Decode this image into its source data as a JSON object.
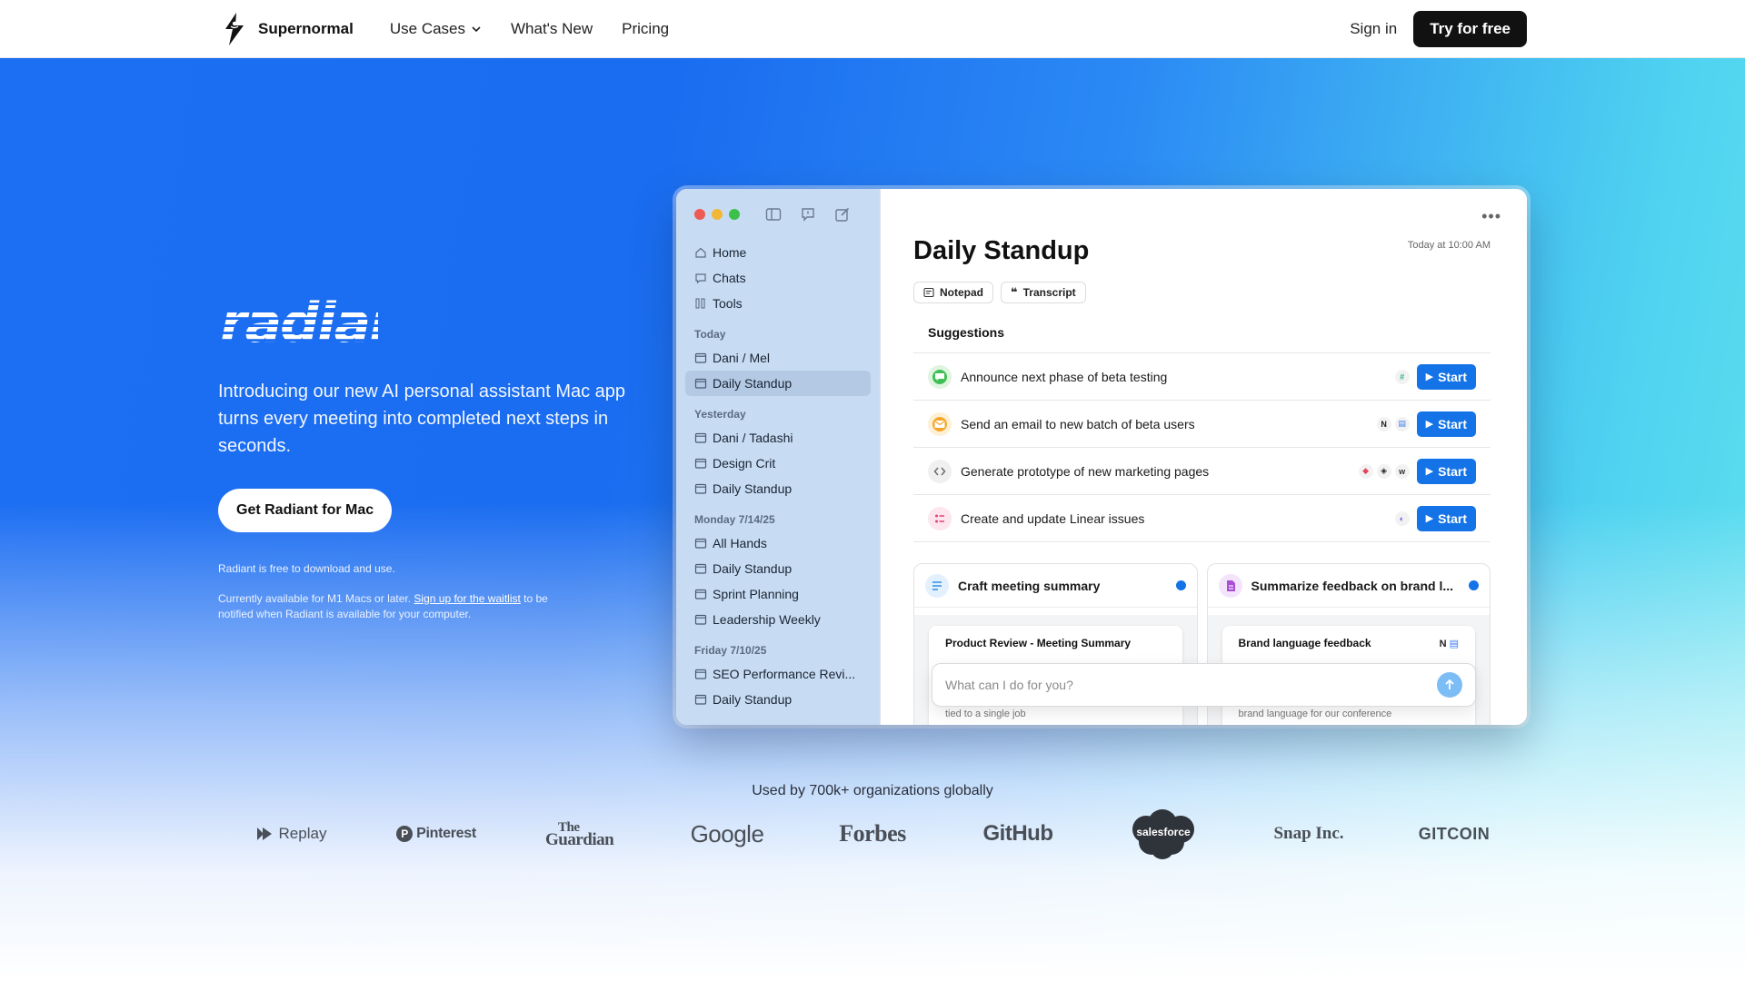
{
  "nav": {
    "brand": "Supernormal",
    "links": {
      "use_cases": "Use Cases",
      "whats_new": "What's New",
      "pricing": "Pricing"
    },
    "sign_in": "Sign in",
    "try_free": "Try for free"
  },
  "hero": {
    "logo_text": "radiant",
    "tagline": "Introducing our new AI personal assistant Mac app turns every meeting into completed next steps in seconds.",
    "cta": "Get Radiant for Mac",
    "note_free": "Radiant is free to download and use.",
    "note_avail_pre": "Currently available for M1 Macs or later. ",
    "note_avail_link": "Sign up for the waitlist",
    "note_avail_post": " to be notified when Radiant is available for your computer."
  },
  "app": {
    "sidebar": {
      "nav": [
        "Home",
        "Chats",
        "Tools"
      ],
      "sections": [
        {
          "label": "Today",
          "items": [
            "Dani / Mel",
            "Daily Standup"
          ]
        },
        {
          "label": "Yesterday",
          "items": [
            "Dani / Tadashi",
            "Design Crit",
            "Daily Standup"
          ]
        },
        {
          "label": "Monday 7/14/25",
          "items": [
            "All Hands",
            "Daily Standup",
            "Sprint Planning",
            "Leadership Weekly"
          ]
        },
        {
          "label": "Friday 7/10/25",
          "items": [
            "SEO Performance Revi...",
            "Daily Standup"
          ]
        }
      ],
      "active_item": "Daily Standup"
    },
    "doc": {
      "title": "Daily Standup",
      "time": "Today at 10:00 AM",
      "chips": [
        "Notepad",
        "Transcript"
      ],
      "suggestions_heading": "Suggestions",
      "suggestions": [
        {
          "text": "Announce next phase of beta testing",
          "icon": "chat-icon",
          "color": "#3fbf55",
          "apps": [
            "slack-icon"
          ]
        },
        {
          "text": "Send an email to new batch of beta users",
          "icon": "mail-icon",
          "color": "#f4a62a",
          "apps": [
            "notion-icon",
            "docs-icon"
          ]
        },
        {
          "text": "Generate prototype of new marketing pages",
          "icon": "code-icon",
          "color": "#888888",
          "apps": [
            "figma-icon",
            "framer-icon",
            "webflow-icon"
          ]
        },
        {
          "text": "Create and update Linear issues",
          "icon": "list-icon",
          "color": "#e0457b",
          "apps": [
            "linear-icon"
          ]
        }
      ],
      "start_label": "Start",
      "cards": [
        {
          "title": "Craft meeting summary",
          "sub_title": "Product Review - Meeting Summary",
          "sub_text": "Focus areas should make it feel personal, not tied to a single job",
          "icon": "summary-icon",
          "color": "#2f8fe8"
        },
        {
          "title": "Summarize feedback on brand l...",
          "sub_title": "Brand language feedback",
          "sub_text": "reviews, here is consolidated feedback on the brand language for our conference",
          "icon": "doc-icon",
          "color": "#a94fd6"
        }
      ],
      "prompt_placeholder": "What can I do for you?"
    }
  },
  "used_by": {
    "text": "Used by 700k+ organizations globally",
    "logos": [
      "Replay",
      "Pinterest",
      "The Guardian",
      "Google",
      "Forbes",
      "GitHub",
      "salesforce",
      "Snap Inc.",
      "GITCOIN"
    ]
  },
  "colors": {
    "accent": "#1473e6",
    "hero_blue": "#1c6ef3",
    "hero_cyan": "#5fe0ee",
    "sidebar": "#c7dcf3"
  }
}
